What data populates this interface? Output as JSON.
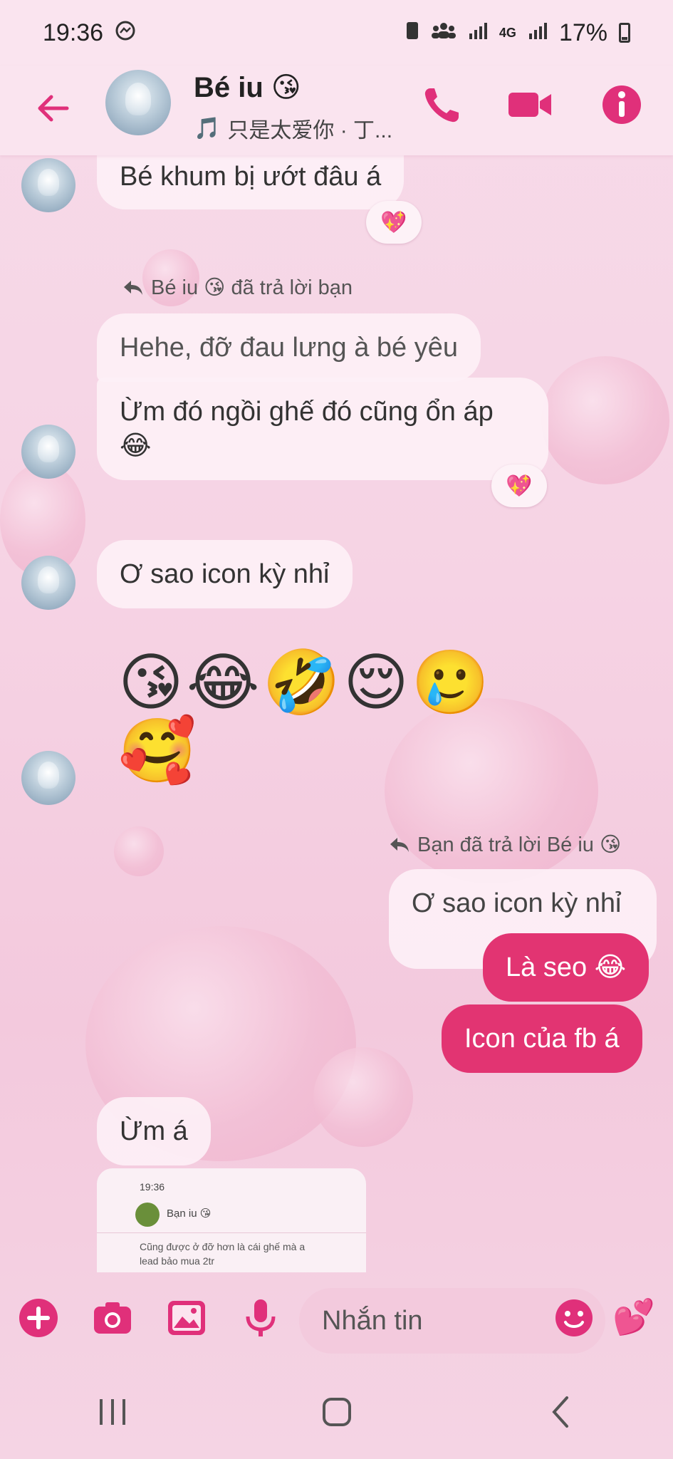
{
  "status_bar": {
    "time": "19:36",
    "battery": "17%",
    "network": "4G",
    "icons": [
      "messenger-icon",
      "sim-icon",
      "family-icon",
      "signal-icon",
      "4g-icon",
      "signal-icon",
      "battery-icon"
    ]
  },
  "header": {
    "contact_name": "Bé iu 😘",
    "now_playing": "只是太爱你 · 丁...",
    "music_icon": "🎵",
    "accent_color": "#e0307a"
  },
  "messages": [
    {
      "side": "left",
      "text": "Bé khum bị ướt đâu á",
      "reaction": "💖"
    },
    {
      "reply_label": "Bé iu 😘 đã trả lời bạn"
    },
    {
      "side": "left",
      "text": "Hehe, đỡ đau lưng à bé yêu",
      "style": "faded"
    },
    {
      "side": "left",
      "text": "Ừm đó ngồi ghế đó cũng ổn áp",
      "text2": "😂",
      "reaction": "💖"
    },
    {
      "side": "left",
      "text": "Ơ sao icon kỳ nhỉ"
    },
    {
      "side": "left",
      "emojis": "😘😂🤣😌🥲",
      "emojis2": "🥰"
    },
    {
      "reply_label": "Bạn đã trả lời Bé iu 😘"
    },
    {
      "side": "right",
      "text": "Ơ sao icon kỳ nhỉ",
      "style": "quoted"
    },
    {
      "side": "right",
      "text": "Là seo 😂"
    },
    {
      "side": "right",
      "text": "Icon của fb á"
    },
    {
      "side": "left",
      "text": "Ừm á"
    }
  ],
  "shared_screenshot": {
    "time": "19:36",
    "title": "Bạn iu 😘",
    "text": "Cũng được ở đỡ hơn là cái ghế mà a lead bảo mua 2tr"
  },
  "composer": {
    "placeholder": "Nhắn tin",
    "quick_reaction": "💕"
  },
  "colors": {
    "accent": "#e0307a",
    "my_bubble": "#e23472",
    "other_bubble": "#fdf0f6"
  }
}
